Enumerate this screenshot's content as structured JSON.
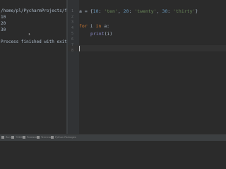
{
  "console": {
    "path": "/home/pl/PycharmProjects/fo",
    "lines": [
      "10",
      "20",
      "30"
    ],
    "finished": "Process finished with exit"
  },
  "editor": {
    "line_numbers": [
      "1",
      "2",
      "3",
      "4",
      "5",
      "6",
      "7",
      "8"
    ],
    "code": {
      "l1_var": "a",
      "l1_eq": " = {",
      "k1": "10",
      "v1": "'ten'",
      "k2": "20",
      "v2": "'twenty'",
      "k3": "30",
      "v3": "'thirty'",
      "l1_close": "}",
      "for_kw": "for",
      "loop_var": " i ",
      "in_kw": "in",
      "iter": " a:",
      "print_fn": "print",
      "print_args": "(i)"
    }
  },
  "statusbar": {
    "items": [
      "Run",
      "TODO",
      "Problems",
      "Terminal",
      "Python Packages"
    ]
  }
}
